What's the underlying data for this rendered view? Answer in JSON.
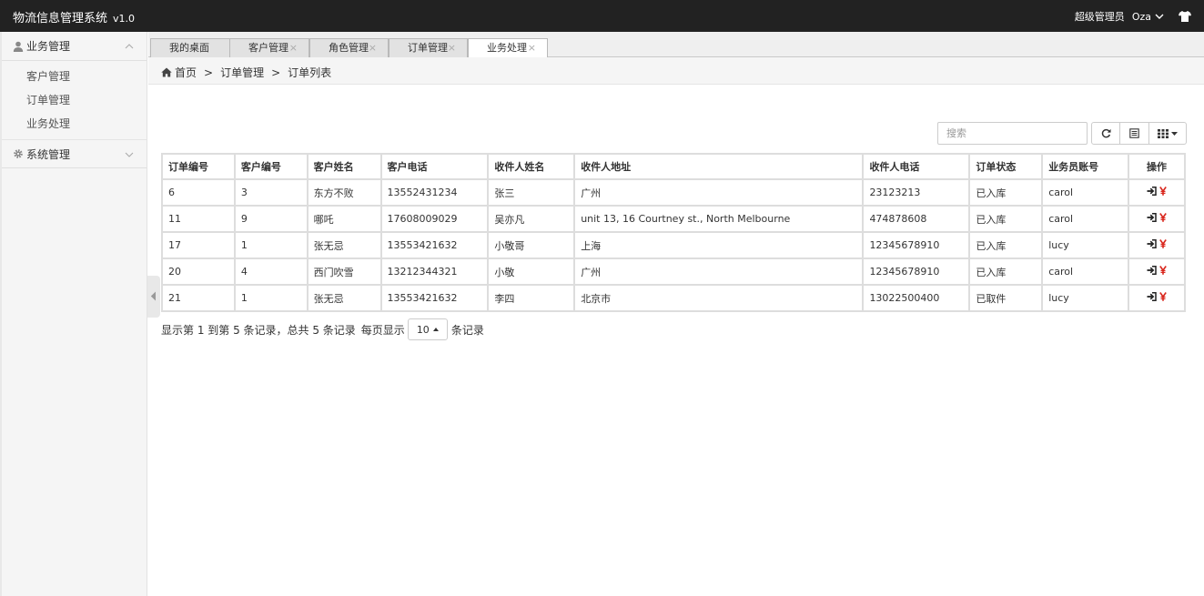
{
  "app": {
    "title": "物流信息管理系统",
    "version": "v1.0"
  },
  "user": {
    "role": "超级管理员",
    "name": "Oza"
  },
  "sidebar": {
    "groups": [
      {
        "label": "业务管理",
        "items": [
          "客户管理",
          "订单管理",
          "业务处理"
        ]
      },
      {
        "label": "系统管理",
        "items": []
      }
    ]
  },
  "tabs": [
    {
      "label": "我的桌面"
    },
    {
      "label": "客户管理"
    },
    {
      "label": "角色管理"
    },
    {
      "label": "订单管理"
    },
    {
      "label": "业务处理"
    }
  ],
  "tab_close_glyph": "×",
  "breadcrumb": {
    "home": "首页",
    "sep": ">",
    "level1": "订单管理",
    "level2": "订单列表"
  },
  "search": {
    "placeholder": "搜索"
  },
  "table": {
    "headers": [
      "订单编号",
      "客户编号",
      "客户姓名",
      "客户电话",
      "收件人姓名",
      "收件人地址",
      "收件人电话",
      "订单状态",
      "业务员账号",
      "操作"
    ],
    "rows": [
      [
        "6",
        "3",
        "东方不败",
        "13552431234",
        "张三",
        "广州",
        "23123213",
        "已入库",
        "carol"
      ],
      [
        "11",
        "9",
        "哪吒",
        "17608009029",
        "吴亦凡",
        "unit 13, 16 Courtney st., North Melbourne",
        "474878608",
        "已入库",
        "carol"
      ],
      [
        "17",
        "1",
        "张无忌",
        "13553421632",
        "小敬哥",
        "上海",
        "12345678910",
        "已入库",
        "lucy"
      ],
      [
        "20",
        "4",
        "西门吹雪",
        "13212344321",
        "小敬",
        "广州",
        "12345678910",
        "已入库",
        "carol"
      ],
      [
        "21",
        "1",
        "张无忌",
        "13553421632",
        "李四",
        "北京市",
        "13022500400",
        "已取件",
        "lucy"
      ]
    ]
  },
  "pager": {
    "info": "显示第 1 到第 5 条记录，总共 5 条记录",
    "per_page_prefix": "每页显示",
    "page_size": "10",
    "per_page_suffix": "条记录"
  },
  "colors": {
    "topbar": "#222222",
    "accent_red": "#d9261c"
  },
  "icons": [
    "user-icon",
    "gear-icon",
    "home-icon",
    "refresh-icon",
    "list-icon",
    "columns-icon",
    "sign-in-icon",
    "yen-icon",
    "shirt-icon"
  ]
}
